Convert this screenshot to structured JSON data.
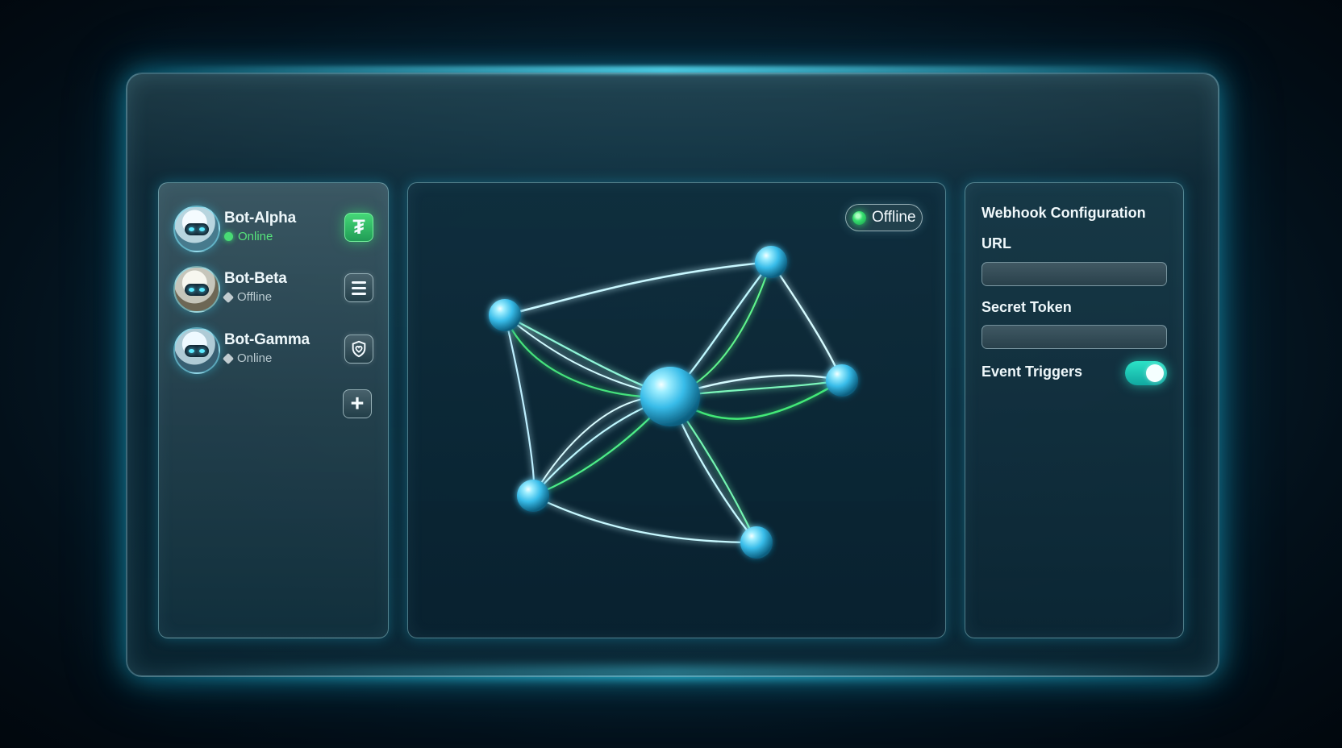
{
  "bots": [
    {
      "name": "Bot-Alpha",
      "status": "Online",
      "action_icon": "green-symbol-icon"
    },
    {
      "name": "Bot-Beta",
      "status": "Offline",
      "action_icon": "menu-icon"
    },
    {
      "name": "Bot-Gamma",
      "status": "Online",
      "action_icon": "shield-heart-icon"
    }
  ],
  "toolbar": {
    "add_icon": "plus-icon"
  },
  "network": {
    "status_badge": "Offline"
  },
  "webhook": {
    "title": "Webhook Configuration",
    "url_label": "URL",
    "url_value": "",
    "secret_label": "Secret Token",
    "secret_value": "",
    "event_triggers_label": "Event Triggers",
    "event_triggers_enabled": true
  },
  "colors": {
    "accent": "#2be2c7",
    "online": "#49db75",
    "glow": "#38d5ff"
  }
}
